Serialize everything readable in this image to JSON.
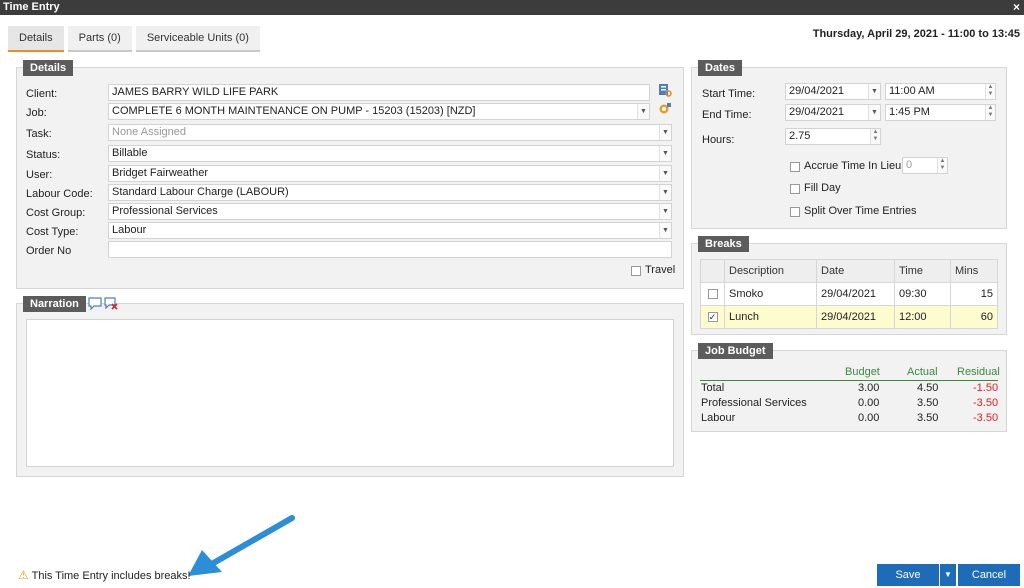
{
  "window": {
    "title": "Time Entry",
    "close": "×"
  },
  "tabs": [
    {
      "label": "Details",
      "active": true
    },
    {
      "label": "Parts (0)",
      "active": false
    },
    {
      "label": "Serviceable Units (0)",
      "active": false
    }
  ],
  "header_datetime": "Thursday, April 29, 2021 - 11:00 to 13:45",
  "details": {
    "title": "Details",
    "client_label": "Client:",
    "client": "JAMES BARRY WILD LIFE PARK",
    "job_label": "Job:",
    "job": "COMPLETE 6 MONTH MAINTENANCE ON PUMP - 15203 (15203) [NZD]",
    "task_label": "Task:",
    "task_placeholder": "None Assigned",
    "status_label": "Status:",
    "status": "Billable",
    "user_label": "User:",
    "user": "Bridget Fairweather",
    "labour_code_label": "Labour Code:",
    "labour_code": "Standard Labour Charge (LABOUR)",
    "cost_group_label": "Cost Group:",
    "cost_group": "Professional Services",
    "cost_type_label": "Cost Type:",
    "cost_type": "Labour",
    "order_no_label": "Order No",
    "order_no": "",
    "travel_label": "Travel"
  },
  "narration": {
    "title": "Narration",
    "text": ""
  },
  "dates": {
    "title": "Dates",
    "start_label": "Start Time:",
    "start_date": "29/04/2021",
    "start_time": "11:00 AM",
    "end_label": "End Time:",
    "end_date": "29/04/2021",
    "end_time": "1:45 PM",
    "hours_label": "Hours:",
    "hours": "2.75",
    "accrue_label": "Accrue Time In Lieu",
    "accrue_value": "0",
    "fill_day_label": "Fill Day",
    "split_label": "Split Over Time Entries"
  },
  "breaks": {
    "title": "Breaks",
    "columns": [
      "Description",
      "Date",
      "Time",
      "Mins"
    ],
    "rows": [
      {
        "description": "Smoko",
        "date": "29/04/2021",
        "time": "09:30",
        "mins": "15",
        "checked": false
      },
      {
        "description": "Lunch",
        "date": "29/04/2021",
        "time": "12:00",
        "mins": "60",
        "checked": true
      }
    ]
  },
  "job_budget": {
    "title": "Job Budget",
    "columns": [
      "Budget",
      "Actual",
      "Residual"
    ],
    "rows": [
      {
        "name": "Total",
        "budget": "3.00",
        "actual": "4.50",
        "residual": "-1.50"
      },
      {
        "name": "Professional Services",
        "budget": "0.00",
        "actual": "3.50",
        "residual": "-3.50"
      },
      {
        "name": "Labour",
        "budget": "0.00",
        "actual": "3.50",
        "residual": "-3.50"
      }
    ]
  },
  "footer": {
    "warning": "This Time Entry includes breaks!",
    "save_label": "Save",
    "cancel_label": "Cancel"
  },
  "colors": {
    "accent": "#f08a24",
    "button": "#1e6bb8",
    "negative": "#e02020",
    "selected_row": "#fdfccf"
  }
}
